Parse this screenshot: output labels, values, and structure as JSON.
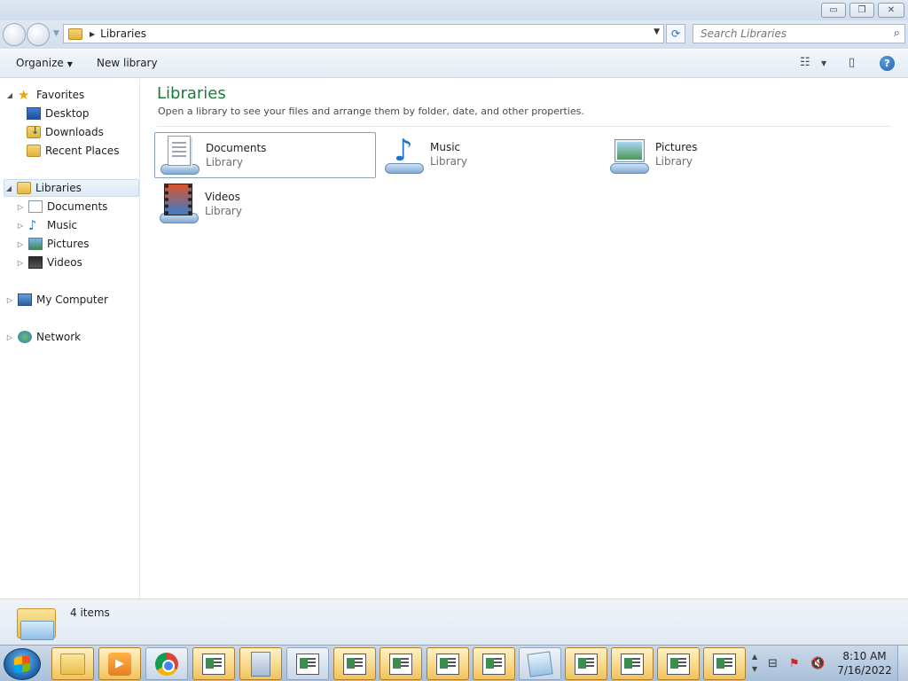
{
  "window": {
    "minimize_glyph": "▭",
    "restore_glyph": "❐",
    "close_glyph": "✕"
  },
  "address_bar": {
    "path": "Libraries",
    "refresh_glyph": "⟳"
  },
  "search": {
    "placeholder": "Search Libraries"
  },
  "toolbar": {
    "organize_label": "Organize",
    "new_library_label": "New library",
    "help_glyph": "?"
  },
  "nav_pane": {
    "favorites": {
      "label": "Favorites",
      "items": [
        "Desktop",
        "Downloads",
        "Recent Places"
      ]
    },
    "libraries": {
      "label": "Libraries",
      "items": [
        "Documents",
        "Music",
        "Pictures",
        "Videos"
      ]
    },
    "computer": {
      "label": "My Computer"
    },
    "network": {
      "label": "Network"
    }
  },
  "content": {
    "title": "Libraries",
    "subtitle": "Open a library to see your files and arrange them by folder, date, and other properties.",
    "libraries": [
      {
        "name": "Documents",
        "kind": "Library",
        "icon": "documents-icon"
      },
      {
        "name": "Music",
        "kind": "Library",
        "icon": "music-icon"
      },
      {
        "name": "Pictures",
        "kind": "Library",
        "icon": "pictures-icon"
      },
      {
        "name": "Videos",
        "kind": "Library",
        "icon": "videos-icon"
      }
    ]
  },
  "status_bar": {
    "item_count": "4 items"
  },
  "taskbar": {
    "clock_time": "8:10 AM",
    "clock_date": "7/16/2022"
  },
  "colors": {
    "title_green": "#1e7a3c",
    "taskbar_active": "#f2c35b",
    "selection_border": "#8aa0b8"
  }
}
